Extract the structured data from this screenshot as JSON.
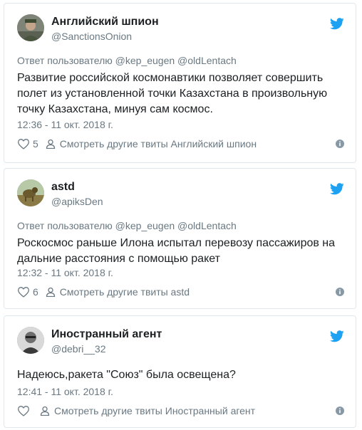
{
  "colors": {
    "accent": "#1da1f2",
    "text": "#1c2022",
    "muted": "#697882",
    "border": "#e1e8ed"
  },
  "tweets": [
    {
      "author_name": "Английский шпион",
      "handle": "@SanctionsOnion",
      "reply_to": "Ответ пользователю @kep_eugen @oldLentach",
      "text": "Развитие российской космонавтики позволяет совершить полет из установленной точки Казахстана в произвольную точку Казахстана, минуя сам космос.",
      "timestamp": "12:36 - 11 окт. 2018 г.",
      "likes": "5",
      "more_link": "Смотреть другие твиты Английский шпион",
      "icons": {
        "avatar": "avatar-icon",
        "bird": "twitter-bird-icon",
        "like": "heart-icon",
        "profile": "person-icon",
        "info": "info-icon"
      }
    },
    {
      "author_name": "astd",
      "handle": "@apiksDen",
      "reply_to": "Ответ пользователю @kep_eugen @oldLentach",
      "text": "Роскосмос раньше Илона испытал перевозу пассажиров на дальние расстояния с помощью ракет",
      "timestamp": "12:32 - 11 окт. 2018 г.",
      "likes": "6",
      "more_link": "Смотреть другие твиты astd",
      "icons": {
        "avatar": "avatar-icon",
        "bird": "twitter-bird-icon",
        "like": "heart-icon",
        "profile": "person-icon",
        "info": "info-icon"
      }
    },
    {
      "author_name": "Иностранный агент",
      "handle": "@debri__32",
      "reply_to": "",
      "text": "Надеюсь,ракета \"Союз\" была освещена?",
      "timestamp": "12:41 - 11 окт. 2018 г.",
      "likes": "",
      "more_link": "Смотреть другие твиты Иностранный агент",
      "icons": {
        "avatar": "avatar-icon",
        "bird": "twitter-bird-icon",
        "like": "heart-icon",
        "profile": "person-icon",
        "info": "info-icon"
      }
    }
  ]
}
